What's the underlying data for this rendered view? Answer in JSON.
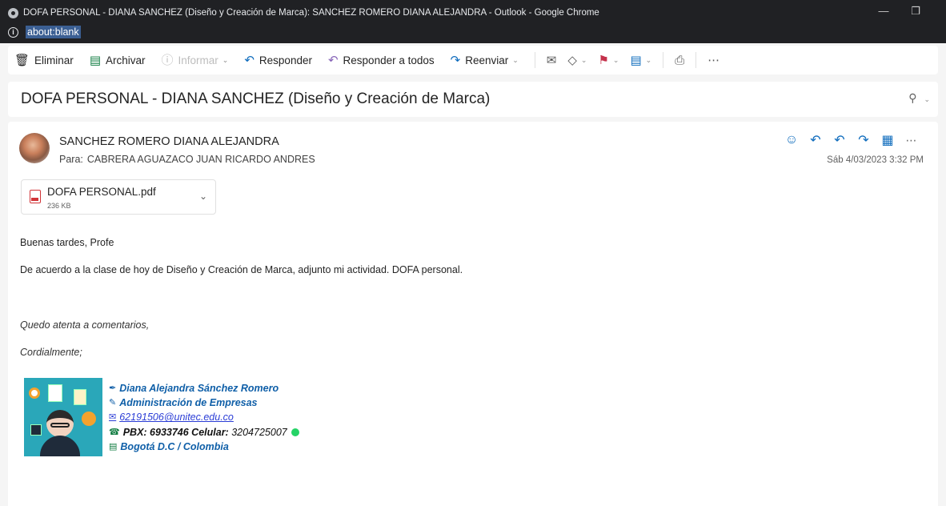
{
  "window": {
    "title": "DOFA PERSONAL - DIANA SANCHEZ (Diseño y Creación de Marca): SANCHEZ ROMERO DIANA ALEJANDRA - Outlook - Google Chrome",
    "url": "about:blank"
  },
  "toolbar": {
    "delete": "Eliminar",
    "archive": "Archivar",
    "report": "Informar",
    "reply": "Responder",
    "reply_all": "Responder a todos",
    "forward": "Reenviar"
  },
  "message": {
    "subject": "DOFA PERSONAL - DIANA SANCHEZ (Diseño y Creación de Marca)",
    "sender": "SANCHEZ ROMERO DIANA ALEJANDRA",
    "to_label": "Para:",
    "to": "CABRERA AGUAZACO JUAN RICARDO ANDRES",
    "date": "Sáb 4/03/2023 3:32 PM",
    "attachment": {
      "name": "DOFA PERSONAL.pdf",
      "size": "236 KB"
    },
    "body": {
      "greeting": "Buenas tardes, Profe",
      "line1": "De acuerdo a la clase de hoy de Diseño y Creación de Marca, adjunto mi actividad. DOFA personal.",
      "closing1": "Quedo atenta a comentarios,",
      "closing2": "Cordialmente;"
    },
    "signature": {
      "name": "Diana Alejandra Sánchez Romero",
      "program": "Administración de Empresas",
      "email": "62191506@unitec.edu.co",
      "phone_label": "PBX:  6933746 Celular:",
      "phone_number": "3204725007",
      "city": "Bogotá D.C / Colombia"
    }
  },
  "colors": {
    "accent": "#0f6cbd",
    "flag": "#c4314b",
    "archive": "#107c41"
  }
}
